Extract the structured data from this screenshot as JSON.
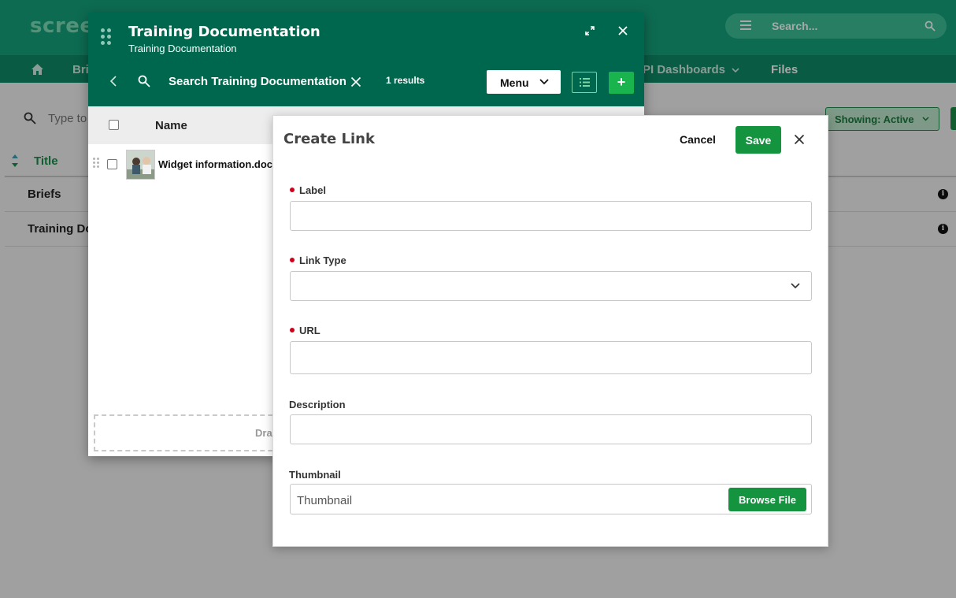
{
  "app": {
    "logo": "scree",
    "search_placeholder": "Search...",
    "nav": [
      "Bri",
      "PI Dashboards",
      "Files"
    ],
    "filter_placeholder": "Type to",
    "showing_label": "Showing: Active",
    "table": {
      "title_header": "Title",
      "rows": [
        "Briefs",
        "Training Do"
      ]
    }
  },
  "panel": {
    "title": "Training Documentation",
    "subtitle": "Training Documentation",
    "search_text": "Search Training Documentation",
    "results": "1 results",
    "menu_label": "Menu",
    "add_label": "+",
    "name_header": "Name",
    "files": [
      {
        "name": "Widget information.doc"
      }
    ],
    "drop_text": "Dra"
  },
  "dialog": {
    "title": "Create Link",
    "cancel_label": "Cancel",
    "save_label": "Save",
    "fields": {
      "label": {
        "label": "Label",
        "required": true,
        "value": ""
      },
      "link_type": {
        "label": "Link Type",
        "required": true,
        "value": ""
      },
      "url": {
        "label": "URL",
        "required": true,
        "value": ""
      },
      "description": {
        "label": "Description",
        "required": false,
        "value": ""
      },
      "thumbnail": {
        "label": "Thumbnail",
        "required": false,
        "placeholder": "Thumbnail",
        "button": "Browse File"
      }
    }
  },
  "colors": {
    "header": "#15a37b",
    "panel_header": "#00674f",
    "primary_button": "#14943f",
    "required_dot": "#d0021b"
  },
  "icons": [
    "menu-icon",
    "search-icon",
    "home-icon",
    "chevron-down-icon",
    "sort-icon",
    "info-icon",
    "drag-handle-icon",
    "expand-icon",
    "close-icon",
    "back-icon",
    "list-view-icon",
    "plus-icon"
  ]
}
